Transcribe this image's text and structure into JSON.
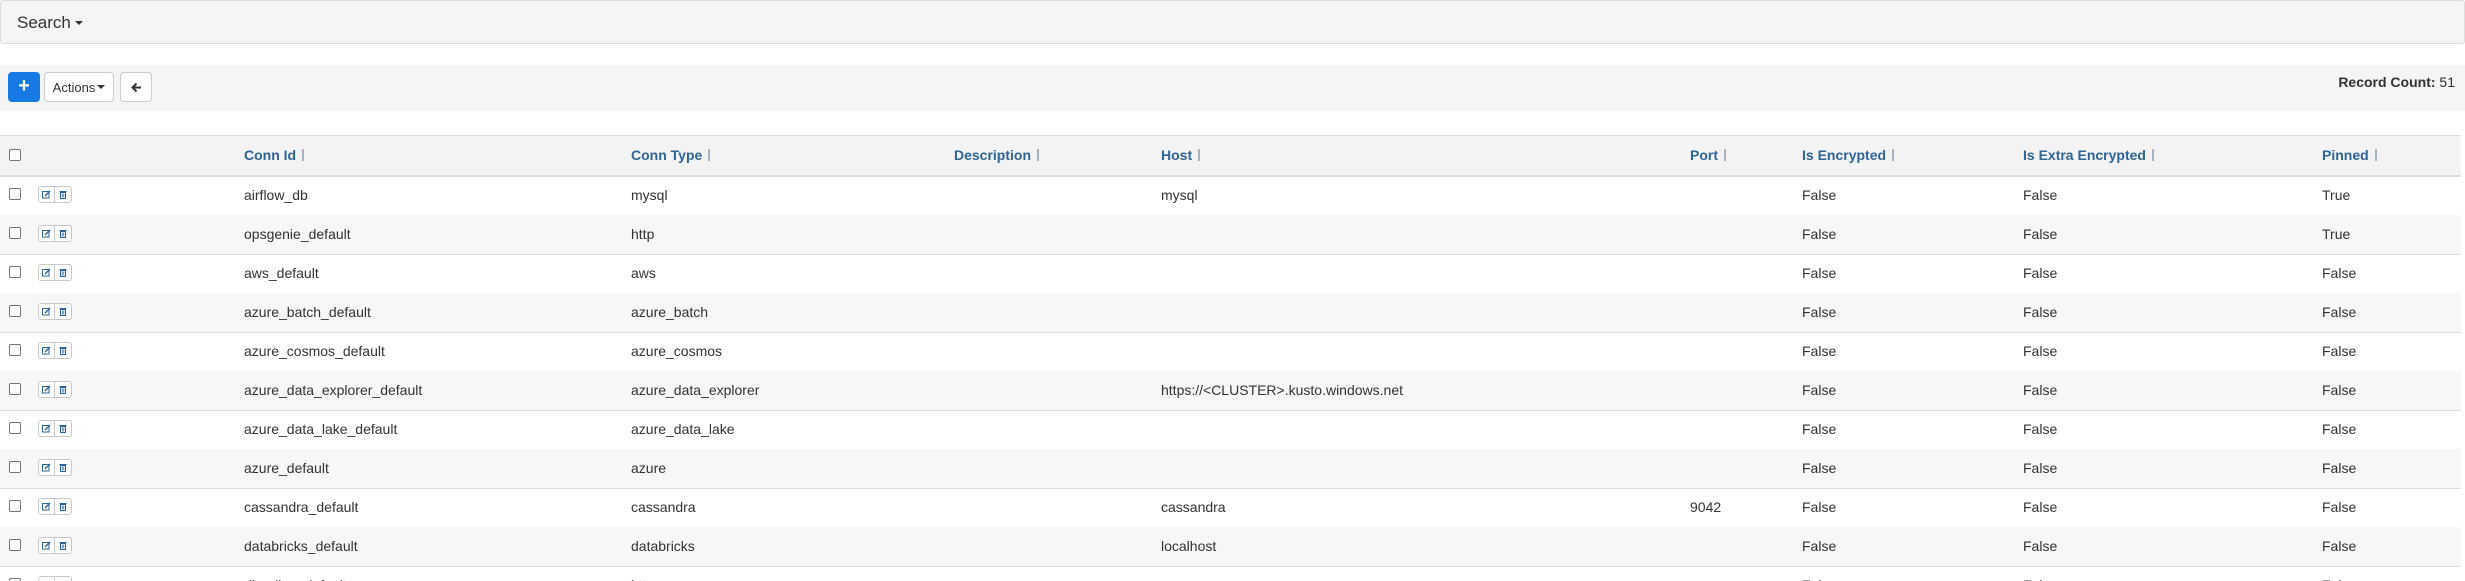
{
  "search": {
    "label": "Search"
  },
  "toolbar": {
    "add_label": "+",
    "actions_label": "Actions",
    "record_count_label": "Record Count:",
    "record_count_value": "51"
  },
  "columns": [
    "Conn Id",
    "Conn Type",
    "Description",
    "Host",
    "Port",
    "Is Encrypted",
    "Is Extra Encrypted",
    "Pinned"
  ],
  "rows": [
    {
      "conn_id": "airflow_db",
      "conn_type": "mysql",
      "description": "",
      "host": "mysql",
      "port": "",
      "is_encrypted": "False",
      "is_extra_encrypted": "False",
      "pinned": "True"
    },
    {
      "conn_id": "opsgenie_default",
      "conn_type": "http",
      "description": "",
      "host": "",
      "port": "",
      "is_encrypted": "False",
      "is_extra_encrypted": "False",
      "pinned": "True"
    },
    {
      "conn_id": "aws_default",
      "conn_type": "aws",
      "description": "",
      "host": "",
      "port": "",
      "is_encrypted": "False",
      "is_extra_encrypted": "False",
      "pinned": "False"
    },
    {
      "conn_id": "azure_batch_default",
      "conn_type": "azure_batch",
      "description": "",
      "host": "",
      "port": "",
      "is_encrypted": "False",
      "is_extra_encrypted": "False",
      "pinned": "False"
    },
    {
      "conn_id": "azure_cosmos_default",
      "conn_type": "azure_cosmos",
      "description": "",
      "host": "",
      "port": "",
      "is_encrypted": "False",
      "is_extra_encrypted": "False",
      "pinned": "False"
    },
    {
      "conn_id": "azure_data_explorer_default",
      "conn_type": "azure_data_explorer",
      "description": "",
      "host": "https://<CLUSTER>.kusto.windows.net",
      "port": "",
      "is_encrypted": "False",
      "is_extra_encrypted": "False",
      "pinned": "False"
    },
    {
      "conn_id": "azure_data_lake_default",
      "conn_type": "azure_data_lake",
      "description": "",
      "host": "",
      "port": "",
      "is_encrypted": "False",
      "is_extra_encrypted": "False",
      "pinned": "False"
    },
    {
      "conn_id": "azure_default",
      "conn_type": "azure",
      "description": "",
      "host": "",
      "port": "",
      "is_encrypted": "False",
      "is_extra_encrypted": "False",
      "pinned": "False"
    },
    {
      "conn_id": "cassandra_default",
      "conn_type": "cassandra",
      "description": "",
      "host": "cassandra",
      "port": "9042",
      "is_encrypted": "False",
      "is_extra_encrypted": "False",
      "pinned": "False"
    },
    {
      "conn_id": "databricks_default",
      "conn_type": "databricks",
      "description": "",
      "host": "localhost",
      "port": "",
      "is_encrypted": "False",
      "is_extra_encrypted": "False",
      "pinned": "False"
    },
    {
      "conn_id": "dingding_default",
      "conn_type": "http",
      "description": "",
      "host": "",
      "port": "",
      "is_encrypted": "False",
      "is_extra_encrypted": "False",
      "pinned": "False"
    }
  ],
  "colors": {
    "primary": "#1779e4",
    "header_link": "#2e6496",
    "toolbar_bg": "#f5f5f5"
  }
}
